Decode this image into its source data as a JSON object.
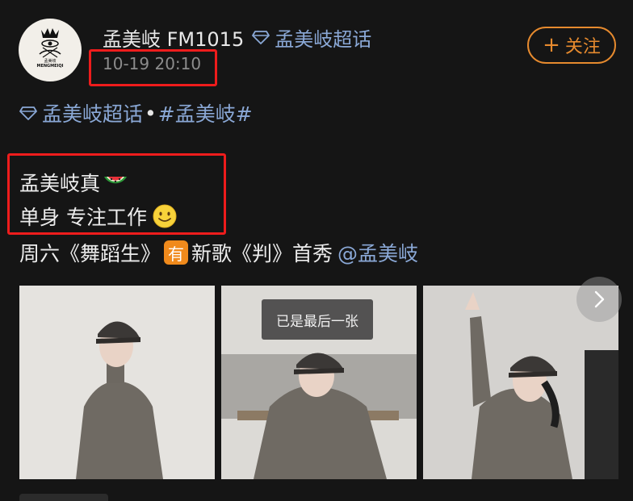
{
  "post": {
    "username": "孟美岐 FM1015",
    "supertopic_link": "孟美岐超话",
    "timestamp": "10-19 20:10",
    "follow_label": "关注",
    "avatar_brand": "孟美岐",
    "avatar_subtext": "MENGMEIQI",
    "topic_tag": "孟美岐超话",
    "topic_hashtag": "#孟美岐#",
    "line1": "孟美岐真",
    "line2": "单身 专注工作",
    "line3_before": "周六《舞蹈生》",
    "line3_badge": "有",
    "line3_after": "新歌《判》首秀",
    "line3_mention": "@孟美岐",
    "toast": "已是最后一张"
  },
  "icons": {
    "supertopic": "diamond-icon",
    "follow": "plus-icon",
    "line1_emoji": "watermelon-emoji",
    "line2_emoji": "smile-emoji",
    "gallery_next": "chevron-right-icon"
  },
  "colors": {
    "background": "#151515",
    "link": "#8aa8d6",
    "follow": "#e68a2e",
    "highlight_box": "#ee1c1c",
    "badge": "#f08a1c"
  }
}
